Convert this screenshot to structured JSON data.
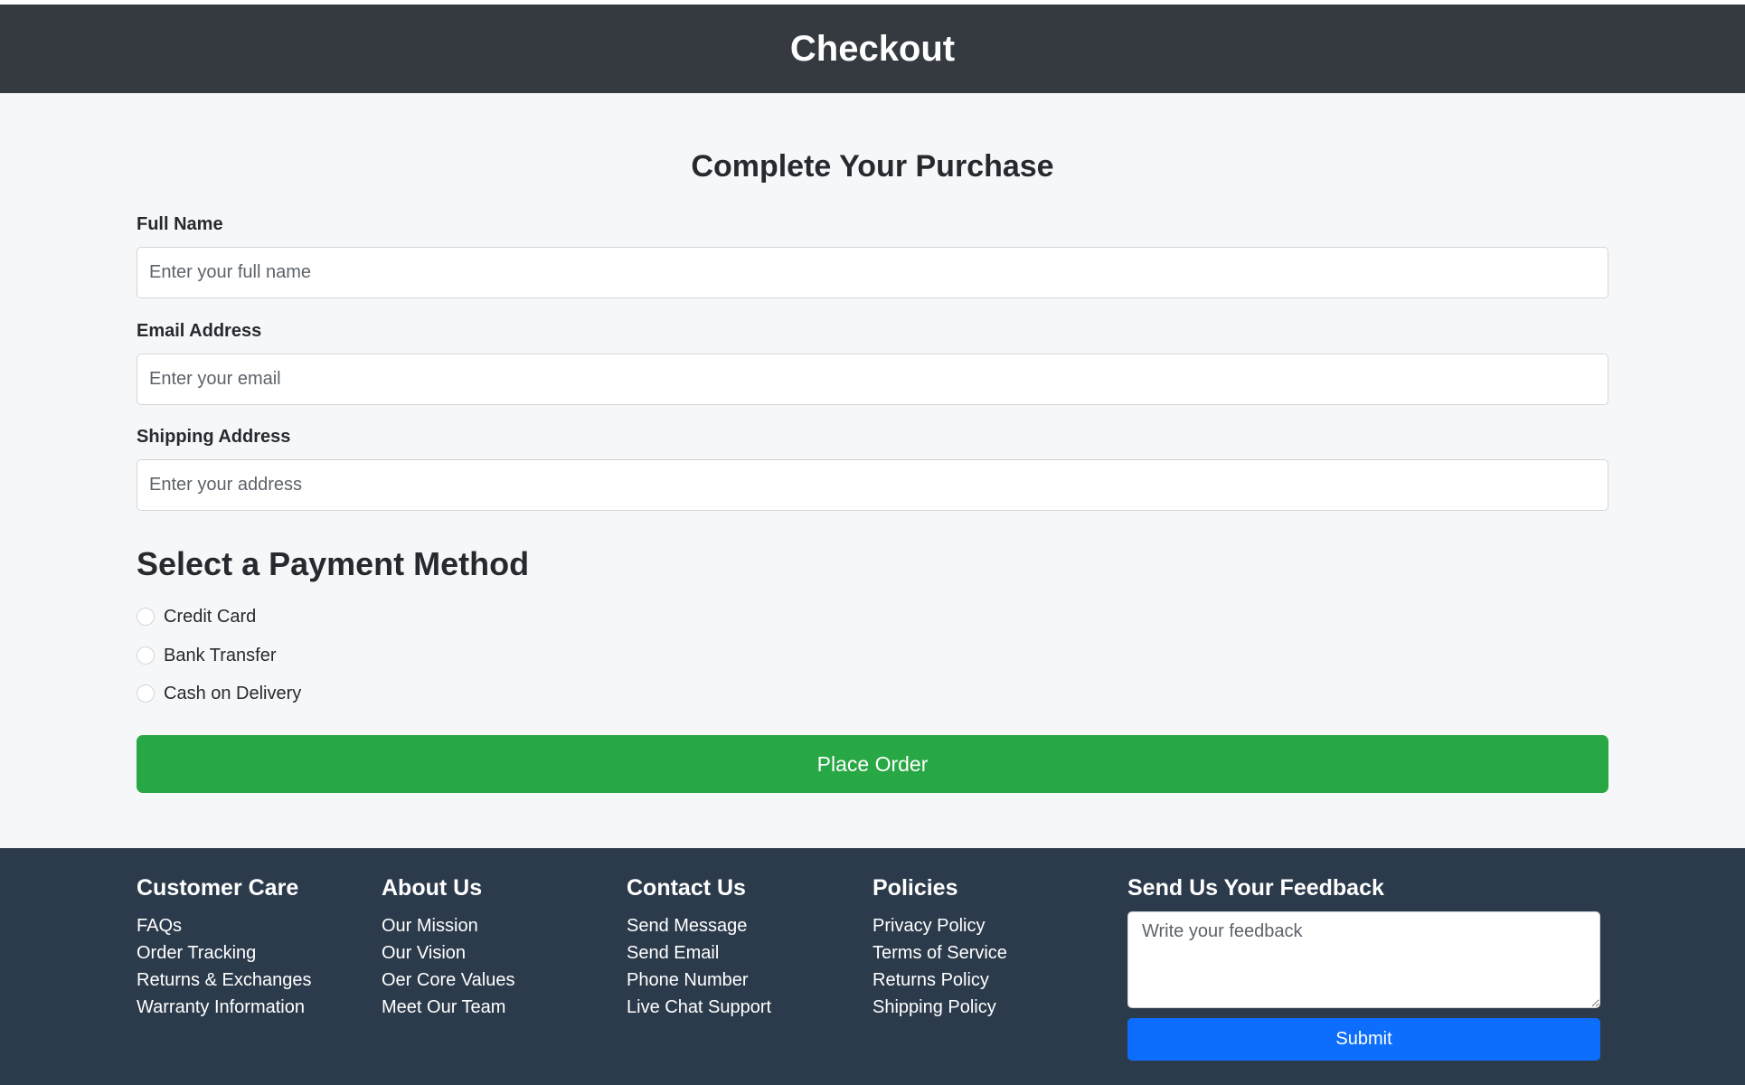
{
  "header": {
    "title": "Checkout"
  },
  "form": {
    "title": "Complete Your Purchase",
    "fields": [
      {
        "label": "Full Name",
        "placeholder": "Enter your full name",
        "value": ""
      },
      {
        "label": "Email Address",
        "placeholder": "Enter your email",
        "value": ""
      },
      {
        "label": "Shipping Address",
        "placeholder": "Enter your address",
        "value": ""
      }
    ]
  },
  "payment": {
    "title": "Select a Payment Method",
    "options": [
      {
        "label": "Credit Card",
        "selected": false
      },
      {
        "label": "Bank Transfer",
        "selected": false
      },
      {
        "label": "Cash on Delivery",
        "selected": false
      }
    ]
  },
  "place_order_label": "Place Order",
  "footer": {
    "columns": [
      {
        "title": "Customer Care",
        "links": [
          "FAQs",
          "Order Tracking",
          "Returns & Exchanges",
          "Warranty Information"
        ]
      },
      {
        "title": "About Us",
        "links": [
          "Our Mission",
          "Our Vision",
          "Oer Core Values",
          "Meet Our Team"
        ]
      },
      {
        "title": "Contact Us",
        "links": [
          "Send Message",
          "Send Email",
          "Phone Number",
          "Live Chat Support"
        ]
      },
      {
        "title": "Policies",
        "links": [
          "Privacy Policy",
          "Terms of Service",
          "Returns Policy",
          "Shipping Policy"
        ]
      }
    ],
    "feedback": {
      "title": "Send Us Your Feedback",
      "placeholder": "Write your feedback",
      "submit_label": "Submit"
    }
  },
  "colors": {
    "header_bg": "#343a40",
    "page_bg": "#f6f7f9",
    "place_order_bg": "#28a745",
    "footer_bg": "#2c3b4c",
    "submit_bg": "#0d6efd"
  }
}
